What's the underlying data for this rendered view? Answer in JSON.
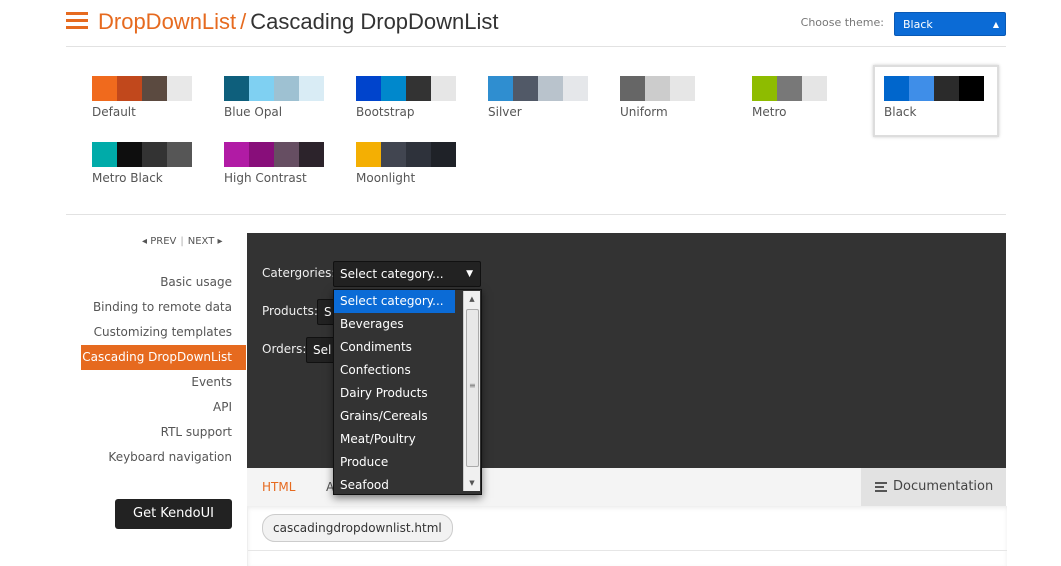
{
  "header": {
    "crumb": "DropDownList",
    "separator": "/",
    "current": "Cascading DropDownList",
    "theme_label": "Choose theme:",
    "theme_value": "Black",
    "accent_color": "#e66a1f"
  },
  "themes": [
    {
      "name": "Default",
      "colors": [
        "#f06a1d",
        "#c1481c",
        "#5b4a40",
        "#e8e8e8"
      ]
    },
    {
      "name": "Blue Opal",
      "colors": [
        "#0e5f7c",
        "#7fd0f2",
        "#9ec1d2",
        "#d9ecf5"
      ]
    },
    {
      "name": "Bootstrap",
      "colors": [
        "#0044cc",
        "#0088cc",
        "#333333",
        "#e6e6e6"
      ]
    },
    {
      "name": "Silver",
      "colors": [
        "#2f8ed0",
        "#515967",
        "#b9c3cc",
        "#e5e7ea"
      ]
    },
    {
      "name": "Uniform",
      "colors": [
        "#666666",
        "#cccccc",
        "#e6e6e6",
        "#ffffff"
      ]
    },
    {
      "name": "Metro",
      "colors": [
        "#8ebc00",
        "#787878",
        "#e5e5e5",
        "#ffffff"
      ]
    },
    {
      "name": "Black",
      "colors": [
        "#0066cc",
        "#3f8ee8",
        "#2b2b2b",
        "#000000"
      ]
    },
    {
      "name": "Metro Black",
      "colors": [
        "#00aba9",
        "#0e0e0e",
        "#333333",
        "#565656"
      ]
    },
    {
      "name": "High Contrast",
      "colors": [
        "#b11ba5",
        "#880e7a",
        "#664e62",
        "#2c232b"
      ]
    },
    {
      "name": "Moonlight",
      "colors": [
        "#f4af03",
        "#414550",
        "#2e323b",
        "#1f2228"
      ]
    }
  ],
  "prevnext": {
    "prev": "PREV",
    "next": "NEXT",
    "prev_icon": "caret-left-icon",
    "next_icon": "caret-right-icon"
  },
  "nav": [
    "Basic usage",
    "Binding to remote data",
    "Customizing templates",
    "Cascading DropDownList",
    "Events",
    "API",
    "RTL support",
    "Keyboard navigation"
  ],
  "nav_active_index": 3,
  "get_button": "Get KendoUI",
  "demo": {
    "categories_label": "Catergories:",
    "categories_value": "Select category...",
    "products_label": "Products:",
    "products_value": "S",
    "orders_label": "Orders:",
    "orders_value": "Sel"
  },
  "dropdown": {
    "items": [
      "Select category...",
      "Beverages",
      "Condiments",
      "Confections",
      "Dairy Products",
      "Grains/Cereals",
      "Meat/Poultry",
      "Produce",
      "Seafood"
    ],
    "selected_index": 0
  },
  "tabs": {
    "html": "HTML",
    "partial": "A",
    "documentation": "Documentation",
    "doc_icon": "list-icon"
  },
  "code": {
    "filename": "cascadingdropdownlist.html"
  }
}
